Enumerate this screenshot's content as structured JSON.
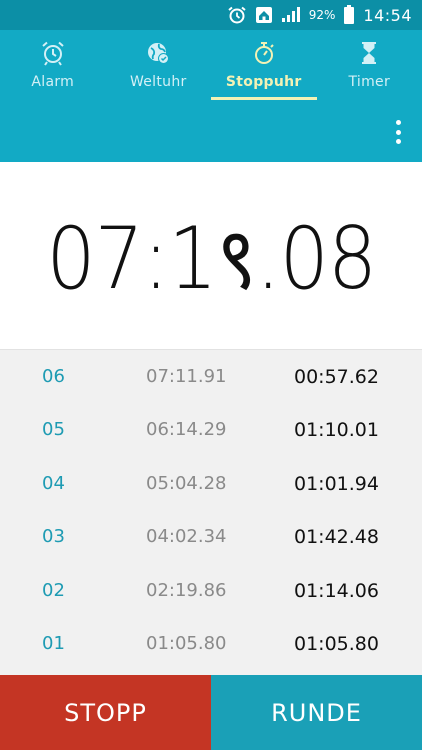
{
  "status_bar": {
    "battery_percent": "92%",
    "time": "14:54",
    "icons": [
      "alarm-icon",
      "home-icon",
      "signal-icon",
      "battery-icon"
    ]
  },
  "tabs": [
    {
      "label": "Alarm",
      "icon": "alarm-clock-icon",
      "active": false
    },
    {
      "label": "Weltuhr",
      "icon": "globe-clock-icon",
      "active": false
    },
    {
      "label": "Stoppuhr",
      "icon": "stopwatch-icon",
      "active": true
    },
    {
      "label": "Timer",
      "icon": "hourglass-icon",
      "active": false
    }
  ],
  "timer": {
    "display": "07:1९.08"
  },
  "laps": [
    {
      "num": "06",
      "total": "07:11.91",
      "split": "00:57.62"
    },
    {
      "num": "05",
      "total": "06:14.29",
      "split": "01:10.01"
    },
    {
      "num": "04",
      "total": "05:04.28",
      "split": "01:01.94"
    },
    {
      "num": "03",
      "total": "04:02.34",
      "split": "01:42.48"
    },
    {
      "num": "02",
      "total": "02:19.86",
      "split": "01:14.06"
    },
    {
      "num": "01",
      "total": "01:05.80",
      "split": "01:05.80"
    }
  ],
  "buttons": {
    "stop_label": "STOPP",
    "lap_label": "RUNDE"
  },
  "colors": {
    "accent": "#12aac5",
    "active_tab": "#f3f2b5",
    "stop": "#c43524",
    "lap": "#1aa0b7"
  }
}
